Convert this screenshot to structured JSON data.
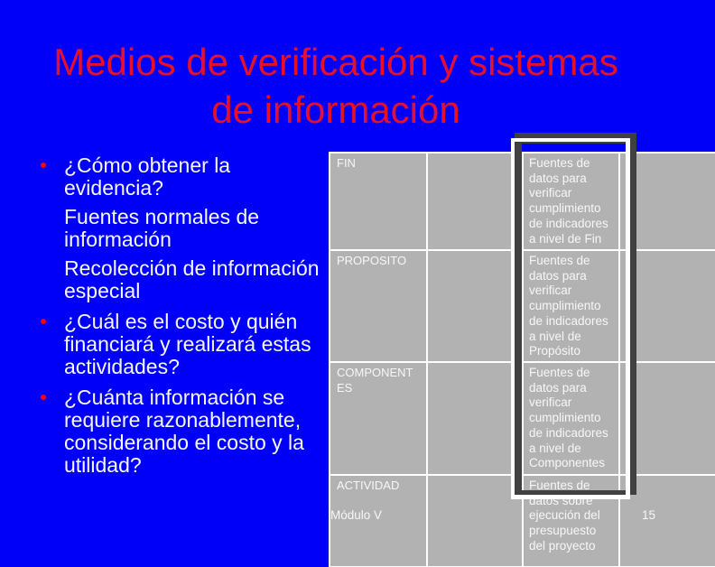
{
  "colors": {
    "background": "#0000fa",
    "title": "#e5102a",
    "bullet": "#ff0000",
    "text": "#f7f7f7",
    "cell": "#b2b2b2",
    "grid": "#ffffff",
    "highlight_frame": "#ffffff",
    "highlight_shadow": "#404040"
  },
  "slide": {
    "title_lines": [
      "Medios de verificación y sistemas",
      "de información"
    ],
    "paragraphs": [
      {
        "type": "bullet",
        "text": "¿Cómo obtener la evidencia?"
      },
      {
        "type": "sub",
        "text": "Fuentes normales de información"
      },
      {
        "type": "sub",
        "text": "Recolección de información especial"
      },
      {
        "type": "bullet",
        "text": "¿Cuál es el costo y quién financiará y realizará estas actividades?"
      },
      {
        "type": "bullet",
        "text": "¿Cuánta información se requiere razonablemente, considerando el costo y la utilidad?"
      }
    ],
    "matrix": {
      "rows": [
        {
          "level": "FIN",
          "indicators": "",
          "sources": "Fuentes de datos para verificar cumplimiento de indicadores a nivel de Fin",
          "assumptions": ""
        },
        {
          "level": "PROPOSITO",
          "indicators": "",
          "sources": "Fuentes de datos para verificar cumplimiento de indicadores a nivel de Propósito",
          "assumptions": ""
        },
        {
          "level": "COMPONENTES",
          "indicators": "",
          "sources": "Fuentes de datos para verificar cumplimiento de indicadores a nivel de Componentes",
          "assumptions": ""
        },
        {
          "level": "ACTIVIDAD",
          "indicators": "",
          "sources": "Fuentes de datos sobre ejecución del presupuesto del proyecto",
          "assumptions": ""
        }
      ]
    },
    "footer": {
      "module": "Módulo V",
      "page_number": "15"
    }
  }
}
